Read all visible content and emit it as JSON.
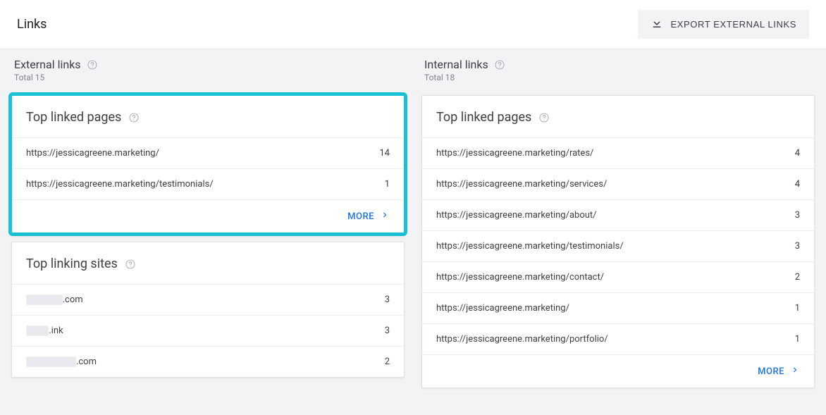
{
  "header": {
    "title": "Links",
    "export_label": "EXPORT EXTERNAL LINKS"
  },
  "external": {
    "title": "External links",
    "total_label": "Total 15",
    "top_linked": {
      "title": "Top linked pages",
      "rows": [
        {
          "url": "https://jessicagreene.marketing/",
          "count": "14"
        },
        {
          "url": "https://jessicagreene.marketing/testimonials/",
          "count": "1"
        }
      ],
      "more_label": "MORE"
    },
    "top_linking_sites": {
      "title": "Top linking sites",
      "rows": [
        {
          "suffix": ".com",
          "count": "3"
        },
        {
          "suffix": ".ink",
          "count": "3"
        },
        {
          "suffix": ".com",
          "count": "2"
        }
      ]
    }
  },
  "internal": {
    "title": "Internal links",
    "total_label": "Total 18",
    "top_linked": {
      "title": "Top linked pages",
      "rows": [
        {
          "url": "https://jessicagreene.marketing/rates/",
          "count": "4"
        },
        {
          "url": "https://jessicagreene.marketing/services/",
          "count": "4"
        },
        {
          "url": "https://jessicagreene.marketing/about/",
          "count": "3"
        },
        {
          "url": "https://jessicagreene.marketing/testimonials/",
          "count": "3"
        },
        {
          "url": "https://jessicagreene.marketing/contact/",
          "count": "2"
        },
        {
          "url": "https://jessicagreene.marketing/",
          "count": "1"
        },
        {
          "url": "https://jessicagreene.marketing/portfolio/",
          "count": "1"
        }
      ],
      "more_label": "MORE"
    }
  }
}
